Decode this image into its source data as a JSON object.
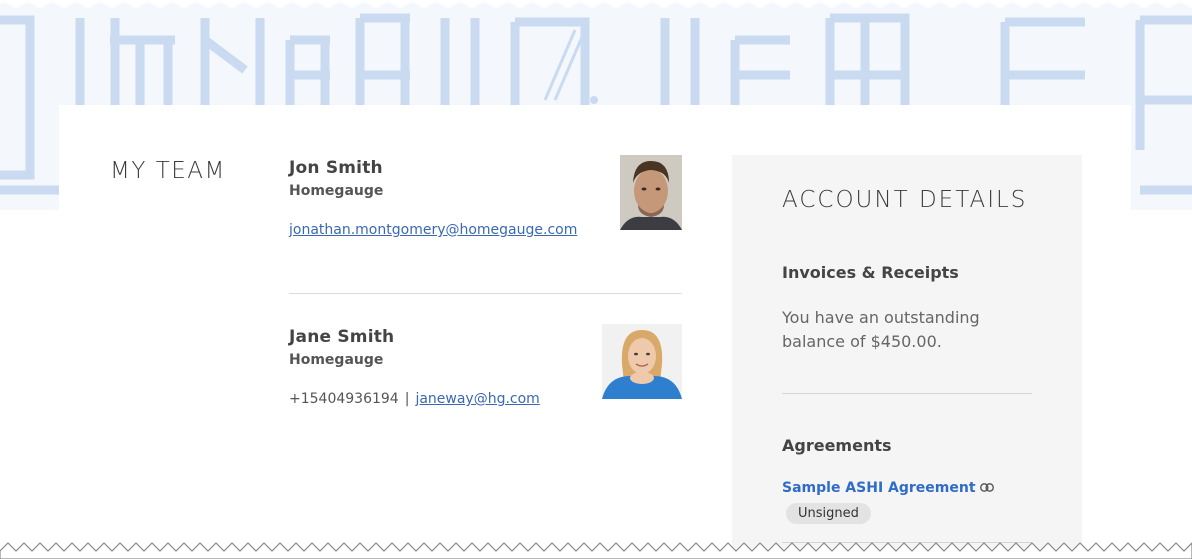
{
  "team": {
    "title": "MY TEAM",
    "members": [
      {
        "name": "Jon Smith",
        "company": "Homegauge",
        "email": "jonathan.montgomery@homegauge.com",
        "avatar": "man-portrait"
      },
      {
        "name": "Jane Smith",
        "company": "Homegauge",
        "phone": "+15404936194",
        "separator": "|",
        "email": "janeway@hg.com",
        "avatar": "woman-portrait"
      }
    ]
  },
  "account": {
    "title": "ACCOUNT DETAILS",
    "invoices_heading": "Invoices & Receipts",
    "balance_text": "You have an outstanding balance of $450.00.",
    "agreements_heading": "Agreements",
    "agreement_link": "Sample ASHI Agreement",
    "agreement_icon": "link-icon",
    "agreement_status": "Unsigned"
  },
  "colors": {
    "link": "#3a68b3",
    "agreement_link": "#2f6cc7",
    "panel_bg": "#f5f5f5",
    "blueprint": "#c6d8f0"
  }
}
